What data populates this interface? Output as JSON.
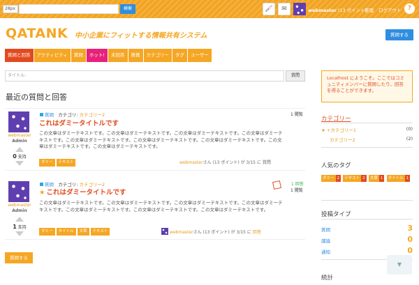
{
  "topbar": {
    "font_size": "28px",
    "search_button": "検索",
    "brush_icon": "🖌",
    "mail_icon": "✉",
    "username": "webmaster",
    "points": "(13 ポイント)",
    "admin_link": "管理",
    "logout_link": "ログアウト",
    "help_icon": "?"
  },
  "header": {
    "logo": "QATANK",
    "tagline": "中小企業にフィットする情報共有システム",
    "ask_button": "質問する"
  },
  "nav": {
    "items": [
      "質問と回答",
      "アクティビティ",
      "質問",
      "ホット!",
      "未回答",
      "懸賞",
      "カテゴリー",
      "タグ",
      "ユーザー"
    ]
  },
  "search": {
    "placeholder": "タイトル:",
    "button": "質問"
  },
  "main": {
    "section_title": "最近の質問と回答",
    "questions": [
      {
        "user": "webmaster",
        "role": "Admin",
        "votes": "0",
        "votes_label": "支持",
        "type": "質問",
        "category_label": "カテゴリ:",
        "category": "カテゴリー2",
        "title": "これはダミータイトルです",
        "body": "この文章はダミーテキストです。この文章はダミーテキストです。この文章はダミーテキストです。この文章はダミーテキストです。この文章はダミーテキストです。この文章はダミーテキストです。この文章はダミーテキストです。この文章はダミーテキストです。この文章はダミーテキストです。",
        "tags": [
          "ダミー",
          "テキスト"
        ],
        "views": "1 閲覧",
        "footer_user": "webmaster",
        "footer_rest": "さん (13 ポイント) が 3/15 に",
        "footer_kind": "質問"
      },
      {
        "user": "webmaster",
        "role": "Admin",
        "votes": "1",
        "votes_label": "支持",
        "type": "質問",
        "category_label": "カテゴリ:",
        "category": "カテゴリー2",
        "title": "これはダミータイトルです",
        "body": "この文章はダミーテキストです。この文章はダミーテキストです。この文章はダミーテキストです。この文章はダミーテキストです。この文章はダミーテキストです。この文章はダミーテキストです。この文章はダミーテキストです。",
        "tags": [
          "ダミー",
          "タイトル",
          "文章",
          "テキスト"
        ],
        "answers": "1 回答",
        "views": "1 閲覧",
        "footer_user": "webmaster",
        "footer_rest": "さん (13 ポイント) が 3/15 に",
        "footer_kind": "回答"
      }
    ],
    "ask_button": "質問する"
  },
  "sidebar": {
    "welcome": "Localhost にようこそ。ここではコミュニティメンバーに質問したり、回答を得ることができます。",
    "categories_title": "カテゴリー",
    "categories": [
      {
        "name": "★ +カテゴリー1",
        "count": "(0)"
      },
      {
        "name": "カテゴリー2",
        "count": "(2)"
      }
    ],
    "popular_tags_title": "人気のタグ",
    "popular_tags": [
      {
        "name": "ダミー",
        "count": "2"
      },
      {
        "name": "テキスト",
        "count": "2"
      },
      {
        "name": "文章",
        "count": "1"
      },
      {
        "name": "タイトル",
        "count": "1"
      }
    ],
    "post_types_title": "投稿タイプ",
    "post_types": [
      {
        "name": "質問",
        "count": "3"
      },
      {
        "name": "議論",
        "count": "0"
      },
      {
        "name": "通知",
        "count": "0"
      }
    ],
    "stats_title": "統計"
  },
  "scroll_icon": "▼"
}
